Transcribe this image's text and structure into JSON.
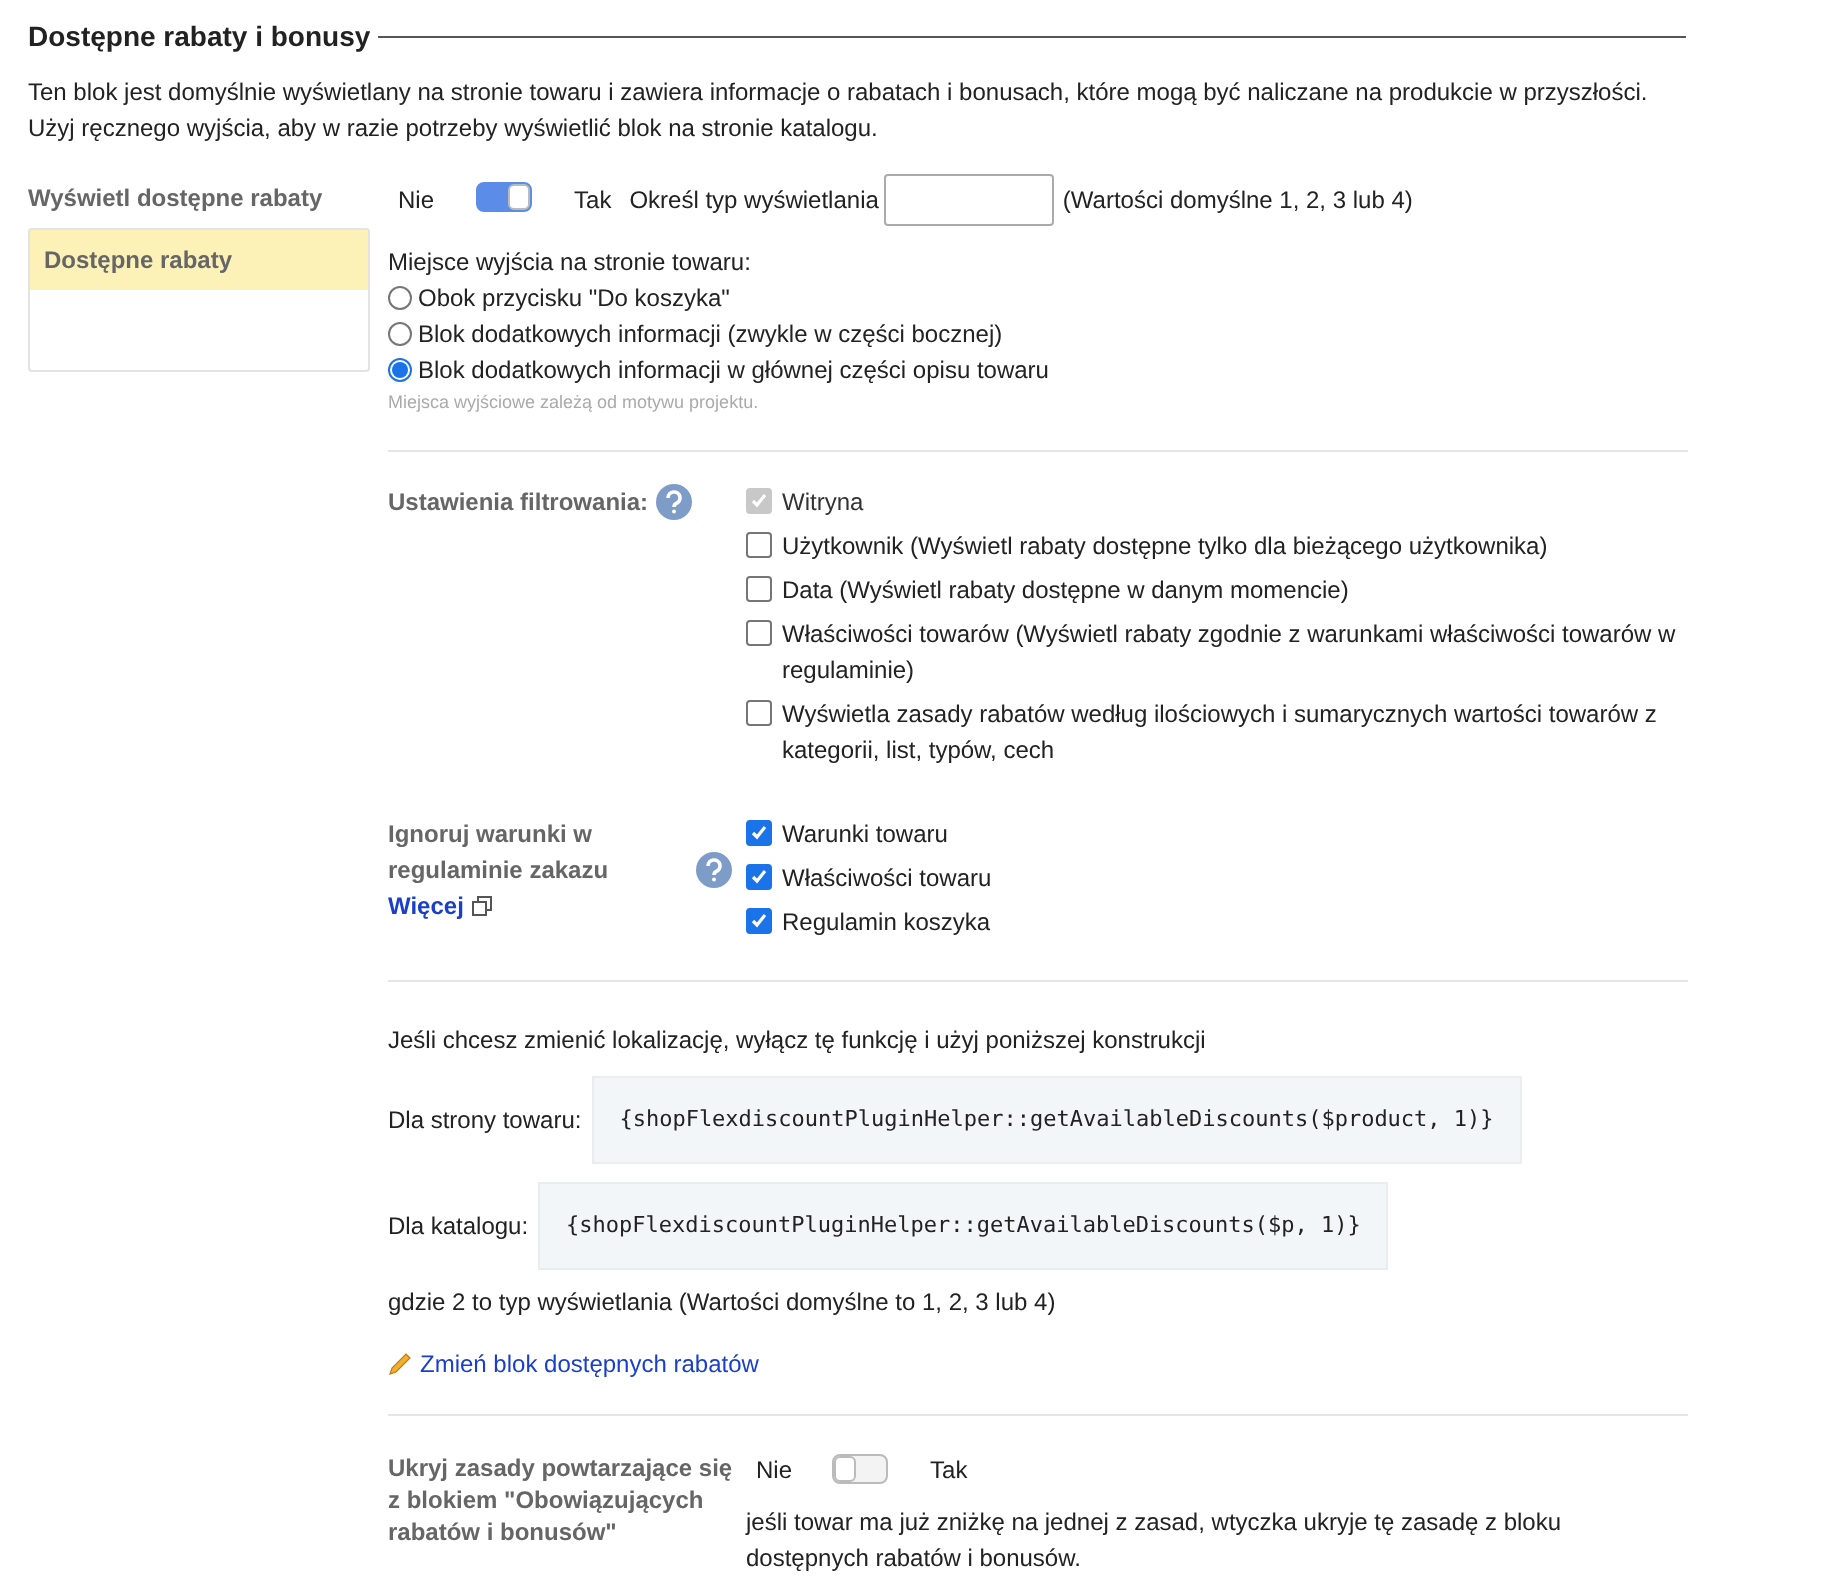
{
  "section": {
    "title": "Dostępne rabaty i bonusy",
    "description": [
      "Ten blok jest domyślnie wyświetlany na stronie towaru i zawiera informacje o rabatach i bonusach, które mogą być naliczane na produkcie w przyszłości.",
      "Użyj ręcznego wyjścia, aby w razie potrzeby wyświetlić blok na stronie katalogu."
    ]
  },
  "sidebar": {
    "title": "Wyświetl dostępne rabaty",
    "items": [
      {
        "label": "Dostępne rabaty",
        "selected": true
      }
    ]
  },
  "display": {
    "off_label": "Nie",
    "on_label": "Tak",
    "on": true,
    "type_label": "Określ typ wyświetlania",
    "type_hint": "(Wartości domyślne 1, 2, 3 lub 4)"
  },
  "output_place": {
    "label": "Miejsce wyjścia na stronie towaru:",
    "options": [
      {
        "label": "Obok przycisku \"Do koszyka\"",
        "selected": false
      },
      {
        "label": "Blok dodatkowych informacji (zwykle w części bocznej)",
        "selected": false
      },
      {
        "label": "Blok dodatkowych informacji w głównej części opisu towaru",
        "selected": true
      }
    ],
    "note": "Miejsca wyjściowe zależą od motywu projektu."
  },
  "filter": {
    "label": "Ustawienia filtrowania:",
    "options": [
      {
        "label": "Witryna",
        "checked": true,
        "disabled": true
      },
      {
        "label": "Użytkownik (Wyświetl rabaty dostępne tylko dla bieżącego użytkownika)",
        "checked": false,
        "disabled": false
      },
      {
        "label": "Data (Wyświetl rabaty dostępne w danym momencie)",
        "checked": false,
        "disabled": false
      },
      {
        "label": "Właściwości towarów (Wyświetl rabaty zgodnie z warunkami właściwości towarów w regulaminie)",
        "checked": false,
        "disabled": false
      },
      {
        "label": "Wyświetla zasady rabatów według ilościowych i sumarycznych wartości towarów z kategorii, list, typów, cech",
        "checked": false,
        "disabled": false
      }
    ]
  },
  "ignore": {
    "label": "Ignoruj warunki w regulaminie zakazu",
    "more_link": "Więcej",
    "options": [
      {
        "label": "Warunki towaru",
        "checked": true
      },
      {
        "label": "Właściwości towaru",
        "checked": true
      },
      {
        "label": "Regulamin koszyka",
        "checked": true
      }
    ]
  },
  "manual": {
    "intro": "Jeśli chcesz zmienić lokalizację, wyłącz tę funkcję i użyj poniższej konstrukcji",
    "snippets": [
      {
        "label": "Dla strony towaru:",
        "code": "{shopFlexdiscountPluginHelper::getAvailableDiscounts($product, 1)}"
      },
      {
        "label": "Dla katalogu:",
        "code": "{shopFlexdiscountPluginHelper::getAvailableDiscounts($p, 1)}"
      }
    ],
    "note": "gdzie 2 to typ wyświetlania (Wartości domyślne to 1, 2, 3 lub 4)",
    "edit_link": "Zmień blok dostępnych rabatów"
  },
  "hide_repeat": {
    "label": "Ukryj zasady powtarzające się z blokiem \"Obowiązujących rabatów i bonusów\"",
    "off_label": "Nie",
    "on_label": "Tak",
    "on": false,
    "description": "jeśli towar ma już zniżkę na jednej z zasad, wtyczka ukryje tę zasadę z bloku dostępnych rabatów i bonusów."
  }
}
